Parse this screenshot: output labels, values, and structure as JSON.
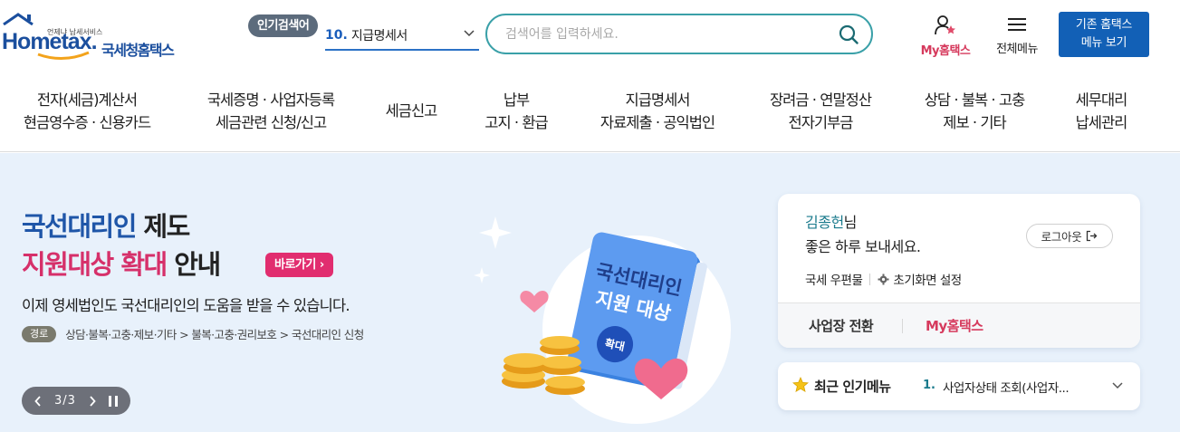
{
  "brand": {
    "tagline": "언제냐 납세서비스",
    "logo_en": "Hometax.",
    "logo_ko": "국세청홈택스"
  },
  "popular_search": {
    "badge": "인기검색어",
    "rank": "10.",
    "term": "지급명세서"
  },
  "search": {
    "placeholder": "검색어를 입력하세요."
  },
  "header_actions": {
    "my_hometax": "My홈택스",
    "all_menu": "전체메뉴",
    "old_menu": "기존 홈택스\n메뉴 보기"
  },
  "gnb": [
    {
      "line1": "전자(세금)계산서",
      "line2": "현금영수증 · 신용카드"
    },
    {
      "line1": "국세증명 · 사업자등록",
      "line2": "세금관련 신청/신고"
    },
    {
      "line1": "세금신고",
      "line2": ""
    },
    {
      "line1": "납부",
      "line2": "고지 · 환급"
    },
    {
      "line1": "지급명세서",
      "line2": "자료제출 · 공익법인"
    },
    {
      "line1": "장려금 · 연말정산",
      "line2": "전자기부금"
    },
    {
      "line1": "상담 · 불복 · 고충",
      "line2": "제보 · 기타"
    },
    {
      "line1": "세무대리",
      "line2": "납세관리"
    }
  ],
  "hero": {
    "title_line1_highlight": "국선대리인",
    "title_line1_rest": " 제도",
    "title_line2_highlight": "지원대상 확대",
    "title_line2_rest": " 안내",
    "goto_label": "바로가기 ›",
    "description": "이제 영세법인도 국선대리인의 도움을 받을 수 있습니다.",
    "route_badge": "경로",
    "route_path": "상담·불복·고충·제보·기타 > 불복·고충·권리보호 > 국선대리인 신청",
    "book_line1": "국선대리인",
    "book_line2": "지원 대상",
    "book_badge": "확대",
    "pager": "3/3"
  },
  "user": {
    "name": "김종헌",
    "suffix": "님",
    "greeting": "좋은 하루 보내세요.",
    "logout": "로그아웃",
    "mail": "국세 우편물",
    "settings": "초기화면 설정",
    "switch_business": "사업장 전환",
    "my_hometax": "My홈택스"
  },
  "recent": {
    "title": "최근 인기메뉴",
    "rank": "1.",
    "item": "사업자상태 조회(사업자..."
  },
  "colors": {
    "brand_blue": "#1b4f9e",
    "accent_pink": "#d63a5d",
    "button_blue": "#1260b6",
    "search_border": "#3aa0a8",
    "visual_bg": "#e8f1fb"
  }
}
